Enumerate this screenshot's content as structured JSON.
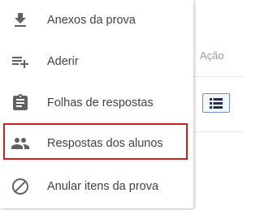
{
  "table": {
    "action_header": "Ação"
  },
  "menu": {
    "items": [
      {
        "label": "Anexos da prova",
        "icon": "download-icon"
      },
      {
        "label": "Aderir",
        "icon": "playlist-add-icon"
      },
      {
        "label": "Folhas de respostas",
        "icon": "clipboard-icon"
      },
      {
        "label": "Respostas dos alunos",
        "icon": "people-icon"
      },
      {
        "label": "Anular itens da prova",
        "icon": "block-icon"
      }
    ],
    "highlighted_item": "Respostas dos alunos"
  },
  "colors": {
    "icon": "#616161",
    "text": "#424242",
    "highlight_border": "#cc1f1f",
    "action_button_border": "#6d8fd0",
    "action_button_icon": "#1f2f4f"
  }
}
